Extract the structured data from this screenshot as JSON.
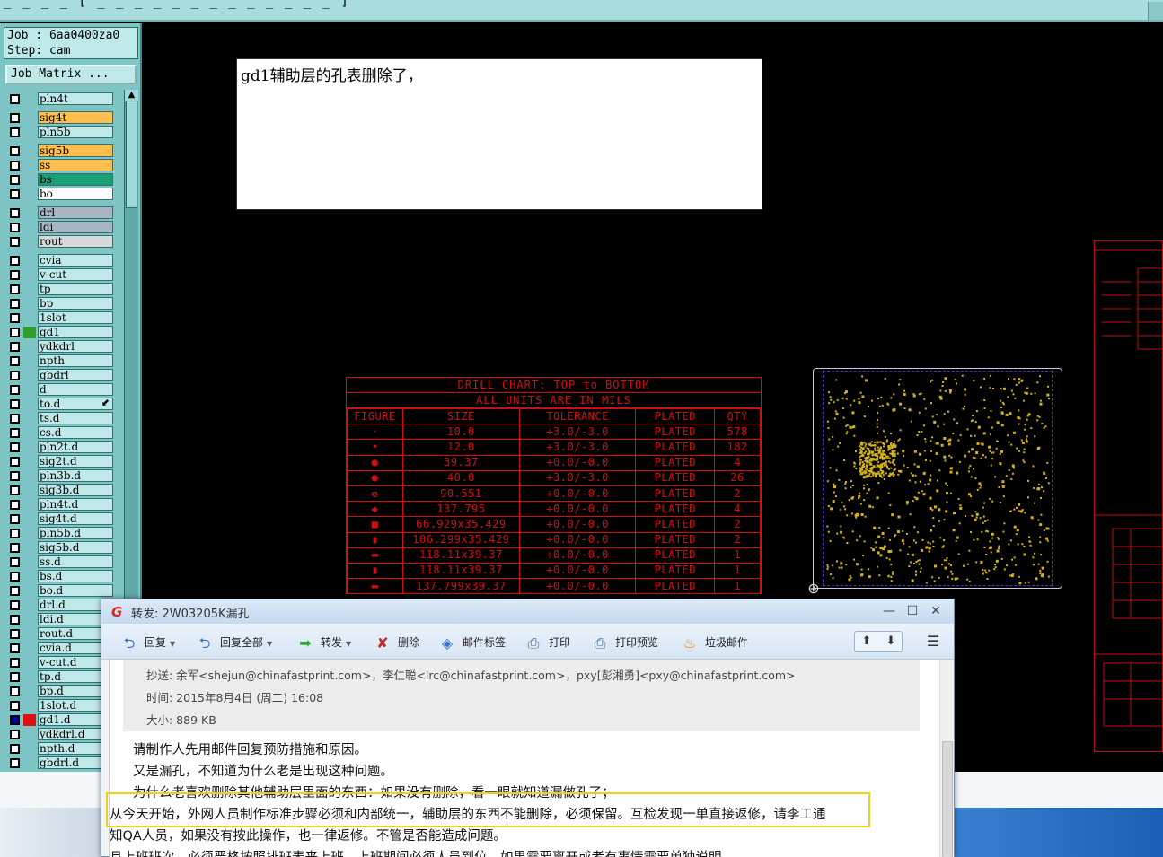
{
  "cam": {
    "top_bar_text": "_ _ _ _ [ _ _ _ _ _ _ _ _ _ _ _ _ _ ]",
    "job_label": "Job : 6aa0400za0",
    "step_label": "Step: cam",
    "job_matrix_button": "Job Matrix ...",
    "layers": [
      {
        "name": "pln4t",
        "color": "#bfe8e8",
        "checked": false
      },
      {
        "name": "sig4t",
        "color": "#ffbf4f",
        "checked": false
      },
      {
        "name": "pln5b",
        "color": "#bfe8e8",
        "checked": false
      },
      {
        "name": "sig5b",
        "color": "#ffbf4f",
        "checked": false
      },
      {
        "name": "ss",
        "color": "#ffbf4f",
        "checked": false
      },
      {
        "name": "bs",
        "color": "#1b9e73",
        "checked": false
      },
      {
        "name": "bo",
        "color": "#ffffff",
        "checked": false
      },
      {
        "name": "drl",
        "color": "#a8b6c4",
        "checked": false
      },
      {
        "name": "ldi",
        "color": "#a8b6c4",
        "checked": false
      },
      {
        "name": "rout",
        "color": "#d8d8d8",
        "checked": false
      },
      {
        "name": "cvia",
        "color": "#bfe8e8",
        "checked": false
      },
      {
        "name": "v-cut",
        "color": "#bfe8e8",
        "checked": false
      },
      {
        "name": "tp",
        "color": "#bfe8e8",
        "checked": false
      },
      {
        "name": "bp",
        "color": "#bfe8e8",
        "checked": false
      },
      {
        "name": "1slot",
        "color": "#bfe8e8",
        "checked": false
      },
      {
        "name": "gd1",
        "color": "#bfe8e8",
        "checked": false,
        "mark": "#2f9e2f"
      },
      {
        "name": "ydkdrl",
        "color": "#bfe8e8",
        "checked": false
      },
      {
        "name": "npth",
        "color": "#bfe8e8",
        "checked": false
      },
      {
        "name": "gbdrl",
        "color": "#bfe8e8",
        "checked": false
      },
      {
        "name": "d",
        "color": "#bfe8e8",
        "checked": false
      },
      {
        "name": "to.d",
        "color": "#bfe8e8",
        "checked": false,
        "arrow": "⬋"
      },
      {
        "name": "ts.d",
        "color": "#bfe8e8",
        "checked": false
      },
      {
        "name": "cs.d",
        "color": "#bfe8e8",
        "checked": false
      },
      {
        "name": "pln2t.d",
        "color": "#bfe8e8",
        "checked": false
      },
      {
        "name": "sig2t.d",
        "color": "#bfe8e8",
        "checked": false
      },
      {
        "name": "pln3b.d",
        "color": "#bfe8e8",
        "checked": false
      },
      {
        "name": "sig3b.d",
        "color": "#bfe8e8",
        "checked": false
      },
      {
        "name": "pln4t.d",
        "color": "#bfe8e8",
        "checked": false
      },
      {
        "name": "sig4t.d",
        "color": "#bfe8e8",
        "checked": false
      },
      {
        "name": "pln5b.d",
        "color": "#bfe8e8",
        "checked": false
      },
      {
        "name": "sig5b.d",
        "color": "#bfe8e8",
        "checked": false
      },
      {
        "name": "ss.d",
        "color": "#bfe8e8",
        "checked": false
      },
      {
        "name": "bs.d",
        "color": "#bfe8e8",
        "checked": false
      },
      {
        "name": "bo.d",
        "color": "#bfe8e8",
        "checked": false
      },
      {
        "name": "drl.d",
        "color": "#bfe8e8",
        "checked": false
      },
      {
        "name": "ldi.d",
        "color": "#bfe8e8",
        "checked": false
      },
      {
        "name": "rout.d",
        "color": "#bfe8e8",
        "checked": false
      },
      {
        "name": "cvia.d",
        "color": "#bfe8e8",
        "checked": false
      },
      {
        "name": "v-cut.d",
        "color": "#bfe8e8",
        "checked": false
      },
      {
        "name": "tp.d",
        "color": "#bfe8e8",
        "checked": false
      },
      {
        "name": "bp.d",
        "color": "#bfe8e8",
        "checked": false
      },
      {
        "name": "1slot.d",
        "color": "#bfe8e8",
        "checked": false
      },
      {
        "name": "gd1.d",
        "color": "#bfe8e8",
        "checked": true,
        "mark": "#e01010"
      },
      {
        "name": "ydkdrl.d",
        "color": "#bfe8e8",
        "checked": false
      },
      {
        "name": "npth.d",
        "color": "#bfe8e8",
        "checked": false
      },
      {
        "name": "gbdrl.d",
        "color": "#bfe8e8",
        "checked": false
      }
    ],
    "note_text": "gd1辅助层的孔表删除了，",
    "drill_chart": {
      "title": "DRILL CHART: TOP to BOTTOM",
      "subtitle": "ALL UNITS ARE IN MILS",
      "headers": [
        "FIGURE",
        "SIZE",
        "TOLERANCE",
        "PLATED",
        "QTY"
      ],
      "rows": [
        {
          "figure": "·",
          "size": "10.0",
          "tolerance": "+3.0/-3.0",
          "plated": "PLATED",
          "qty": "578"
        },
        {
          "figure": "•",
          "size": "12.0",
          "tolerance": "+3.0/-3.0",
          "plated": "PLATED",
          "qty": "182"
        },
        {
          "figure": "●",
          "size": "39.37",
          "tolerance": "+0.0/-0.0",
          "plated": "PLATED",
          "qty": "4"
        },
        {
          "figure": "●",
          "size": "40.0",
          "tolerance": "+3.0/-3.0",
          "plated": "PLATED",
          "qty": "26"
        },
        {
          "figure": "✪",
          "size": "90.551",
          "tolerance": "+0.0/-0.0",
          "plated": "PLATED",
          "qty": "2"
        },
        {
          "figure": "◆",
          "size": "137.795",
          "tolerance": "+0.0/-0.0",
          "plated": "PLATED",
          "qty": "4"
        },
        {
          "figure": "■",
          "size": "66.929x35.429",
          "tolerance": "+0.0/-0.0",
          "plated": "PLATED",
          "qty": "2"
        },
        {
          "figure": "▮",
          "size": "106.299x35.429",
          "tolerance": "+0.0/-0.0",
          "plated": "PLATED",
          "qty": "2"
        },
        {
          "figure": "▬",
          "size": "118.11x39.37",
          "tolerance": "+0.0/-0.0",
          "plated": "PLATED",
          "qty": "1"
        },
        {
          "figure": "▮",
          "size": "118.11x39.37",
          "tolerance": "+0.0/-0.0",
          "plated": "PLATED",
          "qty": "1"
        },
        {
          "figure": "▬",
          "size": "137.799x39.37",
          "tolerance": "+0.0/-0.0",
          "plated": "PLATED",
          "qty": "1"
        }
      ]
    }
  },
  "email": {
    "window_title": "转发: 2W03205K漏孔",
    "logo": "G",
    "toolbar": [
      {
        "label": "回复",
        "icon": "reply-icon",
        "dropdown": true
      },
      {
        "label": "回复全部",
        "icon": "reply-all-icon",
        "dropdown": true
      },
      {
        "label": "转发",
        "icon": "forward-icon",
        "dropdown": true
      },
      {
        "label": "删除",
        "icon": "delete-icon",
        "dropdown": false
      },
      {
        "label": "邮件标签",
        "icon": "tag-icon",
        "dropdown": false
      },
      {
        "label": "打印",
        "icon": "print-icon",
        "dropdown": false
      },
      {
        "label": "打印预览",
        "icon": "print-preview-icon",
        "dropdown": false
      },
      {
        "label": "垃圾邮件",
        "icon": "spam-icon",
        "dropdown": false
      }
    ],
    "cc_line": "抄送: 余军<shejun@chinafastprint.com>，李仁聪<lrc@chinafastprint.com>，pxy[彭湘勇]<pxy@chinafastprint.com>",
    "time_line": "时间: 2015年8月4日 (周二) 16:08",
    "size_line": "大小: 889 KB",
    "body": [
      "请制作人先用邮件回复预防措施和原因。",
      "又是漏孔，不知道为什么老是出现这种问题。",
      "为什么老喜欢删除其他辅助层里面的东西：如果没有删除，看一眼就知道漏做孔了；",
      "从今天开始，外网人员制作标准步骤必须和内部统一，辅助层的东西不能删除，必须保留。互检发现一单直接返修，请李工通",
      "知QA人员，如果没有按此操作，也一律返修。不管是否能造成问题。",
      "且上班班次，必须严格按照排班表来上班，上班期间必须人员到位，如果需要离开或者有事情需要单独说明"
    ]
  }
}
